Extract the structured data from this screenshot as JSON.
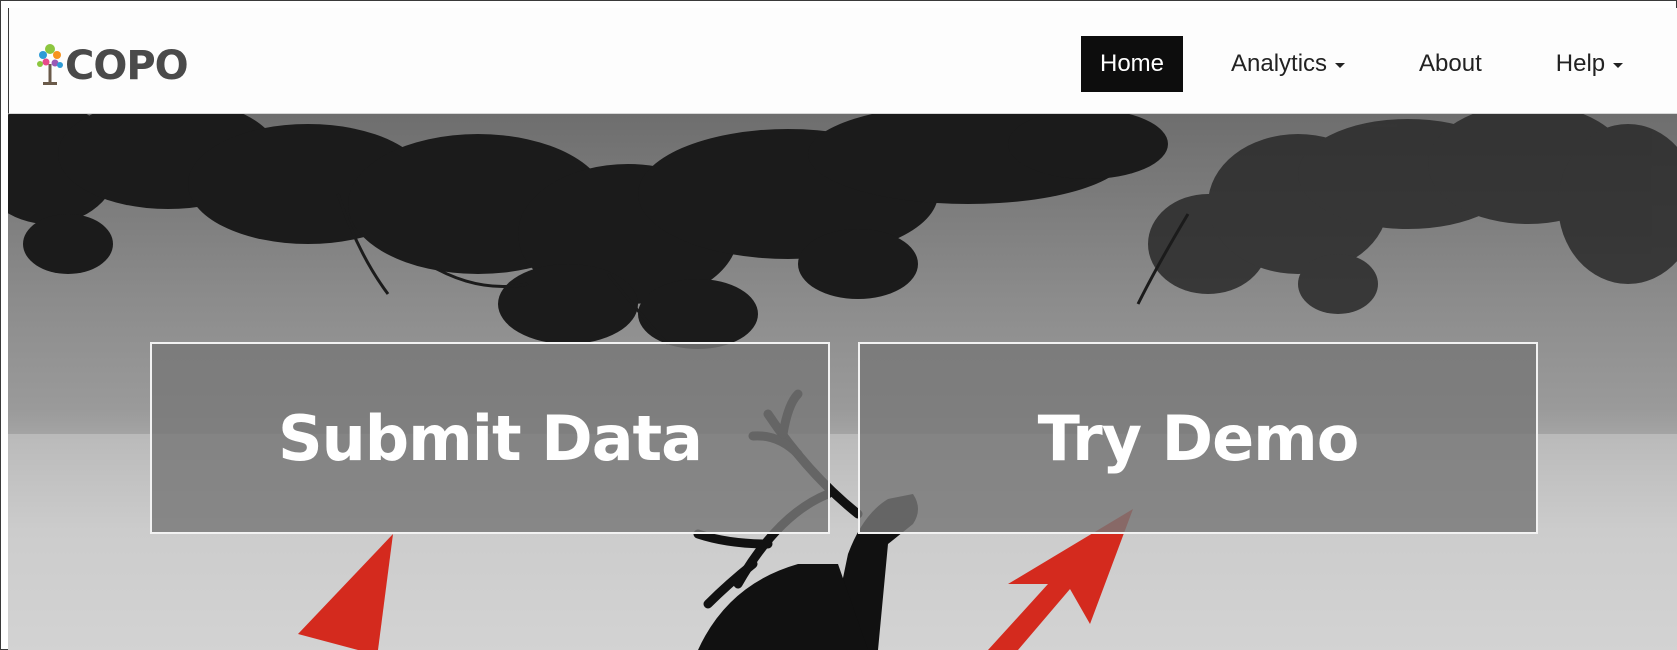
{
  "brand": {
    "name": "COPO",
    "logo_colors": [
      "#2e9bd6",
      "#8cc63f",
      "#f7931e",
      "#e84a8a",
      "#9b59b6"
    ]
  },
  "nav": {
    "home_label": "Home",
    "analytics_label": "Analytics",
    "about_label": "About",
    "help_label": "Help"
  },
  "hero": {
    "submit_label": "Submit Data",
    "demo_label": "Try Demo",
    "arrow_color": "#d42a1e"
  }
}
